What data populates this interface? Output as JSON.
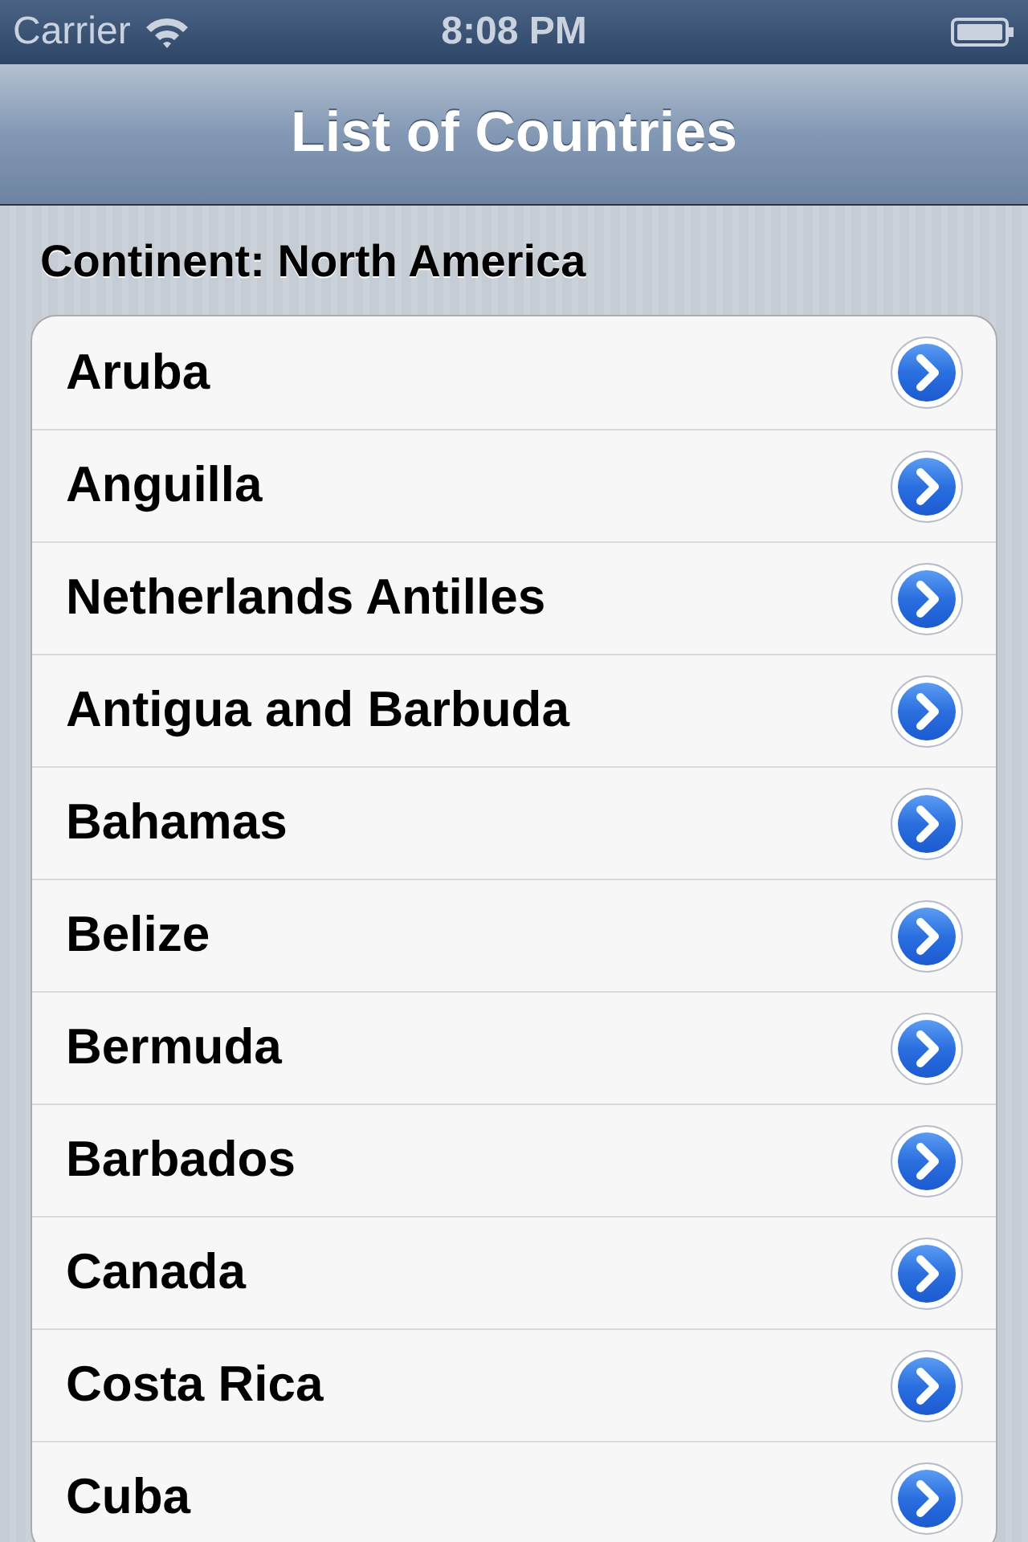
{
  "status_bar": {
    "carrier": "Carrier",
    "time": "8:08 PM"
  },
  "navigation_bar": {
    "title": "List of Countries"
  },
  "section_header": "Continent: North America",
  "rows": [
    {
      "label": "Aruba"
    },
    {
      "label": "Anguilla"
    },
    {
      "label": "Netherlands Antilles"
    },
    {
      "label": "Antigua and Barbuda"
    },
    {
      "label": "Bahamas"
    },
    {
      "label": "Belize"
    },
    {
      "label": "Bermuda"
    },
    {
      "label": "Barbados"
    },
    {
      "label": "Canada"
    },
    {
      "label": "Costa Rica"
    },
    {
      "label": "Cuba"
    }
  ]
}
